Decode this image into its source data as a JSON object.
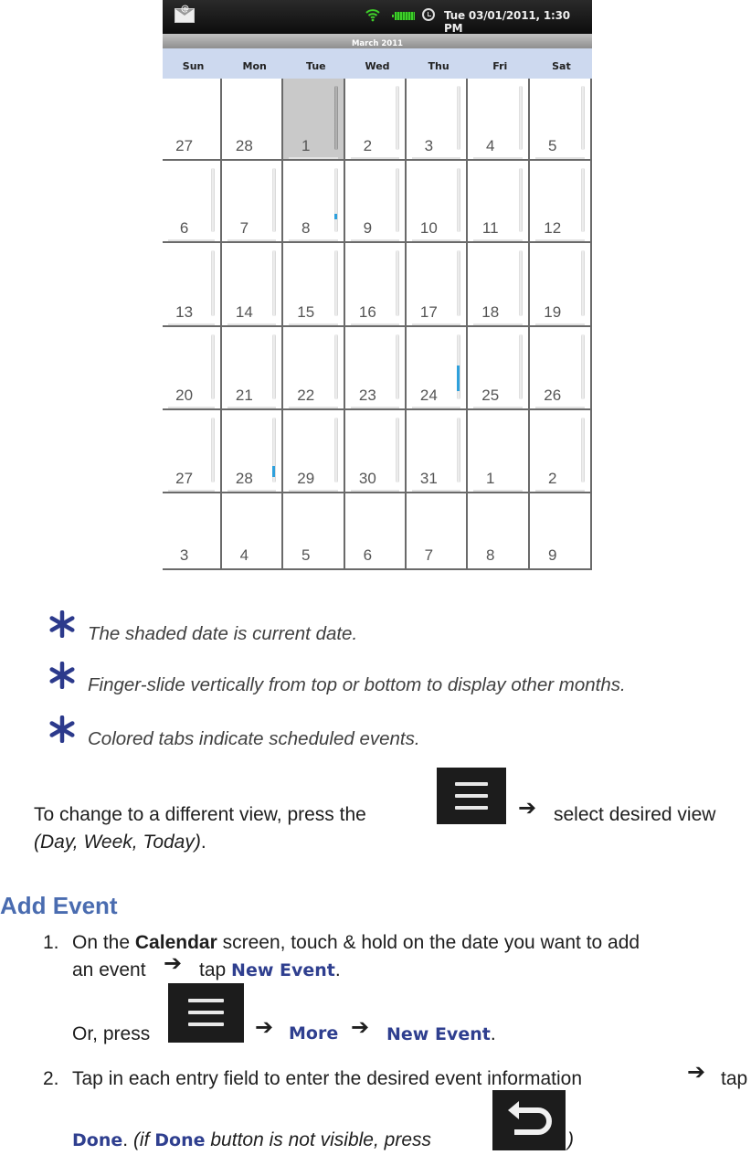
{
  "phone": {
    "status_bar": {
      "icons": [
        "email-notification-icon",
        "wifi-icon",
        "battery-icon",
        "alarm-clock-icon"
      ],
      "datetime": "Tue 03/01/2011, 1:30 PM",
      "colors": {
        "wifi": "#3fcf2a",
        "battery": "#3fcf2a"
      }
    },
    "calendar": {
      "month_title": "March 2011",
      "weekdays": [
        "Sun",
        "Mon",
        "Tue",
        "Wed",
        "Thu",
        "Fri",
        "Sat"
      ],
      "weeks": [
        [
          "27",
          "28",
          "1",
          "2",
          "3",
          "4",
          "5"
        ],
        [
          "6",
          "7",
          "8",
          "9",
          "10",
          "11",
          "12"
        ],
        [
          "13",
          "14",
          "15",
          "16",
          "17",
          "18",
          "19"
        ],
        [
          "20",
          "21",
          "22",
          "23",
          "24",
          "25",
          "26"
        ],
        [
          "27",
          "28",
          "29",
          "30",
          "31",
          "1",
          "2"
        ],
        [
          "3",
          "4",
          "5",
          "6",
          "7",
          "8",
          "9"
        ]
      ],
      "today": {
        "week": 0,
        "day": 2
      },
      "events": [
        {
          "week": 1,
          "day": 2,
          "label": "8"
        },
        {
          "week": 3,
          "day": 4,
          "label": "24"
        },
        {
          "week": 4,
          "day": 1,
          "label": "28"
        }
      ],
      "event_color": "#2ea0dc",
      "today_color": "#c9c9c9",
      "header_color": "#cdd9ef"
    }
  },
  "notes": [
    {
      "icon": "star-bullet-icon",
      "text": "The shaded date is current date."
    },
    {
      "icon": "star-bullet-icon",
      "text": "Finger-slide vertically from top or bottom to display other months."
    },
    {
      "icon": "star-bullet-icon",
      "text": "Colored tabs indicate scheduled events."
    }
  ],
  "change_view": {
    "before": "To change to a different view, press the",
    "after": "select desired view",
    "views": "(Day, Week, Today)",
    "end": "."
  },
  "add_event": {
    "heading": "Add Event",
    "step1": {
      "number": "1.",
      "text_a": "On the",
      "bold": "Calendar",
      "text_b": "screen, touch & hold on the date you want to add",
      "text_c": "an event",
      "tap": "tap",
      "new_event": "New Event",
      "period": ".",
      "or_press": "Or, press",
      "more": "More",
      "new_event_2": "New Event"
    },
    "step2": {
      "number": "2.",
      "text": "Tap in each entry field to enter the desired event information",
      "tap": "tap",
      "done": "Done",
      "period": ".",
      "paren_open": "(if",
      "done_2": "Done",
      "hint": "button is not visible, press",
      "paren_close": ")"
    }
  },
  "colors": {
    "heading": "#4a6cb0",
    "link_text": "#2f3f8f",
    "star": "#2c3a8c"
  }
}
